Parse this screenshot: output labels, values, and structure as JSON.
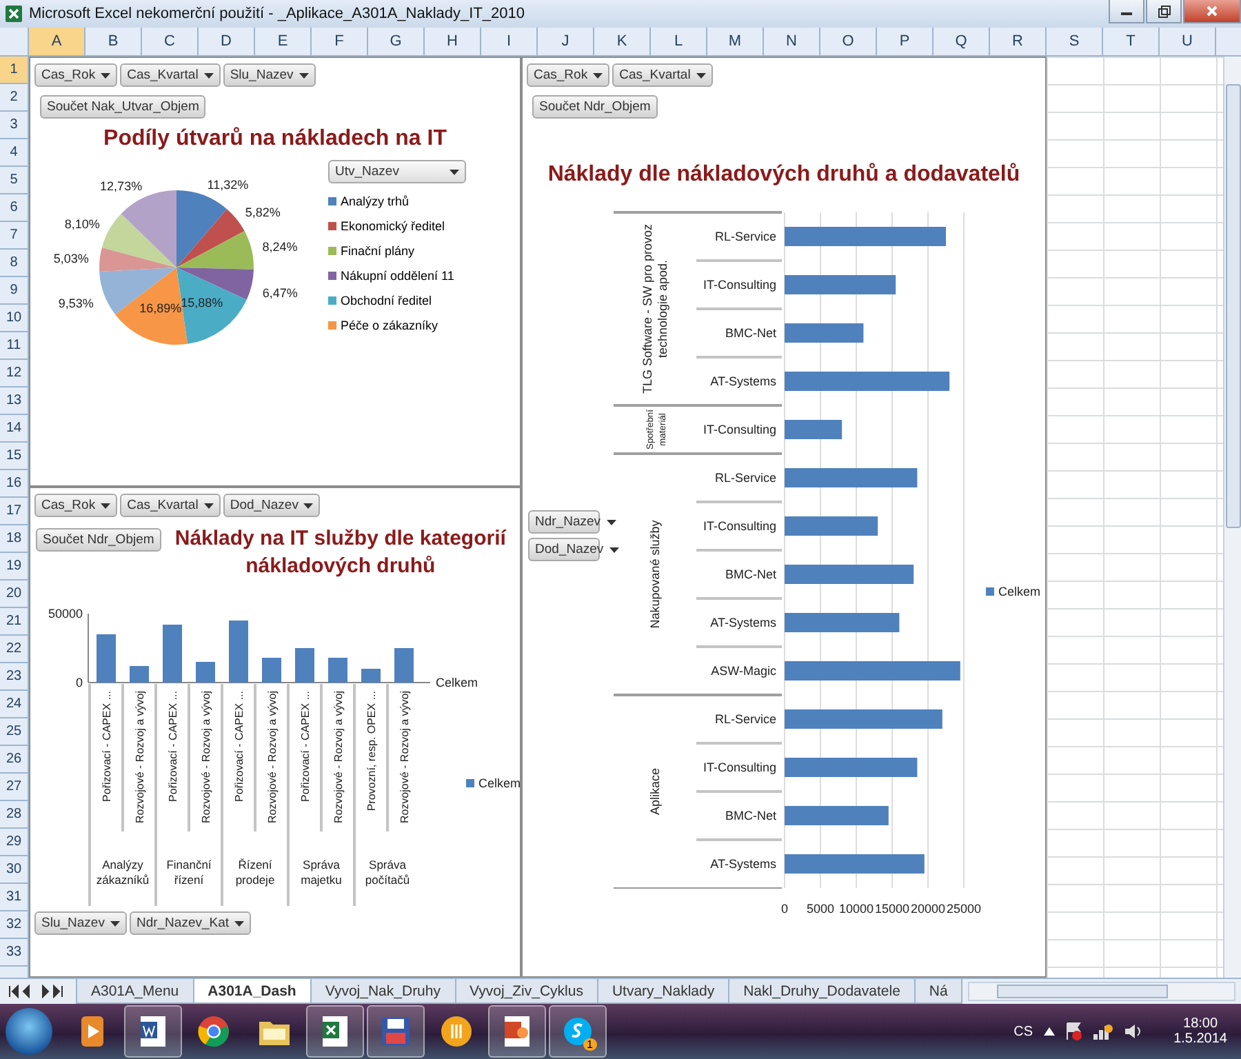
{
  "window": {
    "title": "Microsoft Excel nekomerční použití - _Aplikace_A301A_Naklady_IT_2010"
  },
  "columns": [
    {
      "label": "A",
      "selected": true
    },
    {
      "label": "B",
      "selected": false
    },
    {
      "label": "C",
      "selected": false
    },
    {
      "label": "D",
      "selected": false
    },
    {
      "label": "E",
      "selected": false
    },
    {
      "label": "F",
      "selected": false
    },
    {
      "label": "G",
      "selected": false
    },
    {
      "label": "H",
      "selected": false
    },
    {
      "label": "I",
      "selected": false
    },
    {
      "label": "J",
      "selected": false
    },
    {
      "label": "K",
      "selected": false
    },
    {
      "label": "L",
      "selected": false
    },
    {
      "label": "M",
      "selected": false
    },
    {
      "label": "N",
      "selected": false
    },
    {
      "label": "O",
      "selected": false
    },
    {
      "label": "P",
      "selected": false
    },
    {
      "label": "Q",
      "selected": false
    },
    {
      "label": "R",
      "selected": false
    },
    {
      "label": "S",
      "selected": false
    },
    {
      "label": "T",
      "selected": false
    },
    {
      "label": "U",
      "selected": false
    }
  ],
  "rows": [
    {
      "label": "1",
      "selected": true
    },
    {
      "label": "2",
      "selected": false
    },
    {
      "label": "3",
      "selected": false
    },
    {
      "label": "4",
      "selected": false
    },
    {
      "label": "5",
      "selected": false
    },
    {
      "label": "6",
      "selected": false
    },
    {
      "label": "7",
      "selected": false
    },
    {
      "label": "8",
      "selected": false
    },
    {
      "label": "9",
      "selected": false
    },
    {
      "label": "10",
      "selected": false
    },
    {
      "label": "11",
      "selected": false
    },
    {
      "label": "12",
      "selected": false
    },
    {
      "label": "13",
      "selected": false
    },
    {
      "label": "14",
      "selected": false
    },
    {
      "label": "15",
      "selected": false
    },
    {
      "label": "16",
      "selected": false
    },
    {
      "label": "17",
      "selected": false
    },
    {
      "label": "18",
      "selected": false
    },
    {
      "label": "19",
      "selected": false
    },
    {
      "label": "20",
      "selected": false
    },
    {
      "label": "21",
      "selected": false
    },
    {
      "label": "22",
      "selected": false
    },
    {
      "label": "23",
      "selected": false
    },
    {
      "label": "24",
      "selected": false
    },
    {
      "label": "25",
      "selected": false
    },
    {
      "label": "26",
      "selected": false
    },
    {
      "label": "27",
      "selected": false
    },
    {
      "label": "28",
      "selected": false
    },
    {
      "label": "29",
      "selected": false
    },
    {
      "label": "30",
      "selected": false
    },
    {
      "label": "31",
      "selected": false
    },
    {
      "label": "32",
      "selected": false
    },
    {
      "label": "33",
      "selected": false
    }
  ],
  "pie_panel": {
    "filters": [
      "Cas_Rok",
      "Cas_Kvartal",
      "Slu_Nazev"
    ],
    "value_field": "Součet Nak_Utvar_Objem",
    "legend_field": "Utv_Nazev",
    "legend": [
      {
        "label": "Analýzy trhů",
        "color": "#4f81bd"
      },
      {
        "label": "Ekonomický ředitel",
        "color": "#c0504d"
      },
      {
        "label": "Finační plány",
        "color": "#9bbb59"
      },
      {
        "label": "Nákupní oddělení 11",
        "color": "#8064a2"
      },
      {
        "label": "Obchodní ředitel",
        "color": "#4bacc6"
      },
      {
        "label": "Péče o zákazníky",
        "color": "#f79646"
      }
    ],
    "chart_data": {
      "type": "pie",
      "title": "Podíly útvarů na nákladech na IT",
      "values": [
        11.32,
        5.82,
        8.24,
        6.47,
        15.88,
        16.89,
        9.53,
        5.03,
        8.1,
        12.73
      ],
      "value_labels": [
        "11,32%",
        "5,82%",
        "8,24%",
        "6,47%",
        "15,88%",
        "16,89%",
        "9,53%",
        "5,03%",
        "8,10%",
        "12,73%"
      ]
    }
  },
  "column_panel": {
    "filters": [
      "Cas_Rok",
      "Cas_Kvartal",
      "Dod_Nazev"
    ],
    "value_field": "Součet Ndr_Objem",
    "axis_fields": [
      "Slu_Nazev",
      "Ndr_Nazev_Kat"
    ],
    "depth_axis_label": "Celkem",
    "chart_data": {
      "type": "bar",
      "title": "Náklady na IT služby dle kategorií nákladových druhů",
      "categories": [
        "Pořizovací - CAPEX ...",
        "Rozvojové - Rozvoj a vývoj",
        "Pořizovací - CAPEX ...",
        "Rozvojové - Rozvoj a vývoj",
        "Pořizovací - CAPEX ...",
        "Rozvojové - Rozvoj a vývoj",
        "Pořizovací - CAPEX ...",
        "Rozvojové - Rozvoj a vývoj",
        "Provozní, resp. OPEX ...",
        "Rozvojové - Rozvoj a vývoj"
      ],
      "series": [
        {
          "name": "Celkem",
          "color": "#4f81bd",
          "values": [
            35000,
            12000,
            42000,
            15000,
            45000,
            18000,
            25000,
            18000,
            10000,
            25000
          ]
        }
      ],
      "yticks": [
        0,
        50000
      ],
      "ylim": [
        0,
        50000
      ]
    },
    "category_groups": [
      "Analýzy zákazníků",
      "Finanční řízení",
      "Řízení prodeje",
      "Správa majetku",
      "Správa počítačů"
    ],
    "category_group_start": [
      true,
      false,
      true,
      false,
      true,
      false,
      true,
      false,
      true,
      false
    ]
  },
  "bar_panel": {
    "filters": [
      "Cas_Rok",
      "Cas_Kvartal"
    ],
    "value_field": "Součet Ndr_Objem",
    "row_fields": [
      "Ndr_Nazev",
      "Dod_Nazev"
    ],
    "chart_data": {
      "type": "bar",
      "orientation": "horizontal",
      "title": "Náklady dle nákladových druhů a dodavatelů",
      "categories": [
        "RL-Service",
        "IT-Consulting",
        "BMC-Net",
        "AT-Systems",
        "IT-Consulting",
        "RL-Service",
        "IT-Consulting",
        "BMC-Net",
        "AT-Systems",
        "ASW-Magic",
        "RL-Service",
        "IT-Consulting",
        "BMC-Net",
        "AT-Systems"
      ],
      "series": [
        {
          "name": "Celkem",
          "color": "#4f81bd",
          "values": [
            22500,
            15500,
            11000,
            23000,
            8000,
            18500,
            13000,
            18000,
            16000,
            24500,
            22000,
            18500,
            14500,
            19500
          ]
        }
      ],
      "xticks": [
        0,
        5000,
        10000,
        15000,
        20000,
        25000
      ],
      "xlim": [
        0,
        25000
      ],
      "grid": true
    },
    "category_groups": [
      "TLG Software - SW pro provoz technologie apod.",
      "Spotřební materiál",
      "Nakupované služby",
      "Aplikace"
    ],
    "category_group_start": [
      true,
      false,
      false,
      false,
      true,
      true,
      false,
      false,
      false,
      false,
      true,
      false,
      false,
      false
    ]
  },
  "sheet_tabs": [
    {
      "label": "A301A_Menu",
      "selected": false
    },
    {
      "label": "A301A_Dash",
      "selected": true
    },
    {
      "label": "Vyvoj_Nak_Druhy",
      "selected": false
    },
    {
      "label": "Vyvoj_Ziv_Cyklus",
      "selected": false
    },
    {
      "label": "Utvary_Naklady",
      "selected": false
    },
    {
      "label": "Nakl_Druhy_Dodavatele",
      "selected": false
    },
    {
      "label": "Ná",
      "selected": false
    }
  ],
  "taskbar": {
    "apps": [
      {
        "running": false
      },
      {
        "running": true
      },
      {
        "running": false
      },
      {
        "running": false
      },
      {
        "running": true
      },
      {
        "running": true
      },
      {
        "running": false
      },
      {
        "running": true
      },
      {
        "running": true,
        "badge": "1"
      }
    ],
    "language": "CS",
    "time": "18:00",
    "date": "1.5.2014"
  }
}
